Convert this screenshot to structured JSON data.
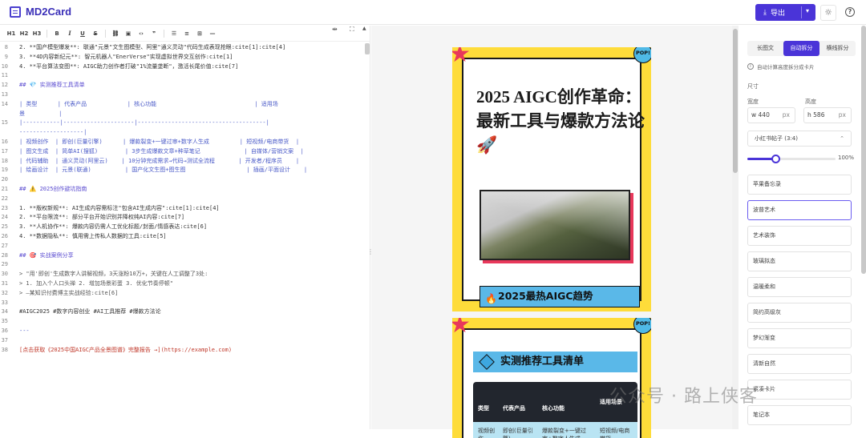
{
  "app": {
    "name": "MD2Card",
    "export_label": "导出",
    "help": "?"
  },
  "toolbar": {
    "h1": "H1",
    "h2": "H2",
    "h3": "H3",
    "bold": "B",
    "italic": "I",
    "underline": "U",
    "strike": "S"
  },
  "editor": {
    "lines": [
      {
        "n": "8",
        "t": "2. **国产模型爆发**: 联通\"元景\"文生图模型、阿里\"通义灵动\"代码生成表现抢眼:cite[1]:cite[4]"
      },
      {
        "n": "9",
        "t": "3. **4D内容新纪元**: 智元机器人\"EnerVerse\"实现虚拟世界交互创作:cite[1]"
      },
      {
        "n": "10",
        "t": "4. **平台算法变图**: AIGC助力创作者打破\"1%流量垄断\"，激活长尾价值:cite[7]"
      },
      {
        "n": "11",
        "t": ""
      },
      {
        "n": "12",
        "t": "## 💎 实测推荐工具清单"
      },
      {
        "n": "13",
        "t": ""
      },
      {
        "n": "14",
        "t": "| 类型      | 代表产品            | 核心功能                             | 适用场"
      },
      {
        "n": "",
        "t": "景          |"
      },
      {
        "n": "15",
        "t": "|-----------|---------------------|--------------------------------------|"
      },
      {
        "n": "",
        "t": "-------------------|"
      },
      {
        "n": "16",
        "t": "| 视频创作  | 即创(巨量引擎)      | 爆款裂变+一键过审+数字人生成         | 短视频/电商带货  |"
      },
      {
        "n": "17",
        "t": "| 图文生成  | 简单AI(搜狐)        | 3步生成爆款文章+种草笔记             | 自媒体/营销文案  |"
      },
      {
        "n": "18",
        "t": "| 代码辅助  | 通义灵动(阿里云)    | 10分钟完成需求→代码→测试全流程       | 开发者/程序员    |"
      },
      {
        "n": "19",
        "t": "| 绘画设计  | 元景(联通)          | 国产化文生图+图生图                  | 插画/平面设计    |"
      },
      {
        "n": "20",
        "t": ""
      },
      {
        "n": "21",
        "t": "## ⚠️ 2025创作避坑指南"
      },
      {
        "n": "22",
        "t": ""
      },
      {
        "n": "23",
        "t": "1. **版权新规**: AI生成内容需标注\"包含AI生成内容\":cite[1]:cite[4]"
      },
      {
        "n": "24",
        "t": "2. **平台限流**: 部分平台开始识别并降权纯AI内容:cite[7]"
      },
      {
        "n": "25",
        "t": "3. **人机协作**: 爆款内容仍需人工优化标题/封面/情感表达:cite[6]"
      },
      {
        "n": "26",
        "t": "4. **数据隐私**: 慎用需上传私人数据的工具:cite[5]"
      },
      {
        "n": "27",
        "t": ""
      },
      {
        "n": "28",
        "t": "## 🎯 实战案例分享"
      },
      {
        "n": "29",
        "t": ""
      },
      {
        "n": "30",
        "t": "> \"用'即创'生成数字人讲解视频，3天涨粉10万+，关键在人工调整了3处:"
      },
      {
        "n": "31",
        "t": "> 1. 加入个人口头禅 2. 增加场景彩蛋 3. 优化节奏停顿\""
      },
      {
        "n": "32",
        "t": "> —某知识付费博主实战经验:cite[6]"
      },
      {
        "n": "33",
        "t": ""
      },
      {
        "n": "34",
        "t": "#AIGC2025 #数字内容创业 #AI工具推荐 #爆款方法论"
      },
      {
        "n": "35",
        "t": ""
      },
      {
        "n": "36",
        "t": "---"
      },
      {
        "n": "37",
        "t": ""
      },
      {
        "n": "38",
        "t": "[点击获取《2025中国AIGC产品全景图谱》完整报告 →](https://example.com)"
      }
    ]
  },
  "preview": {
    "card1": {
      "pop": "POP!",
      "title": "2025 AIGC创作革命：最新工具与爆款方法论 🚀",
      "banner": "2025最热AIGC趋势"
    },
    "card2": {
      "pop": "POP!",
      "banner": "实测推荐工具清单",
      "headers": [
        "类型",
        "代表产品",
        "核心功能",
        "适用场景"
      ],
      "row": [
        "视频创作",
        "即创(巨量引擎)",
        "爆款裂变+一键过审+数字人生成",
        "短视频/电商带货"
      ]
    }
  },
  "panel": {
    "tabs": [
      "长图文",
      "自动拆分",
      "横线拆分"
    ],
    "hint": "自动计算高度拆分成卡片",
    "size_label": "尺寸",
    "width_label": "宽度",
    "width_prefix": "w",
    "width_value": "440",
    "width_unit": "px",
    "height_label": "高度",
    "height_prefix": "h",
    "height_value": "586",
    "height_unit": "px",
    "preset": "小红书帖子 (3:4)",
    "zoom": "100%",
    "styles": [
      "苹果备忘录",
      "波普艺术",
      "艺术装饰",
      "玻璃拟态",
      "温暖柔和",
      "简约高级灰",
      "梦幻渐变",
      "清新自然",
      "紧凑卡片",
      "笔记本"
    ]
  },
  "watermark": "公众号 · 路上侠客",
  "colors": {
    "accent": "#4a34d8",
    "card_bg": "#fedc3a",
    "pink": "#e8385b",
    "blue": "#5ab8e8"
  }
}
